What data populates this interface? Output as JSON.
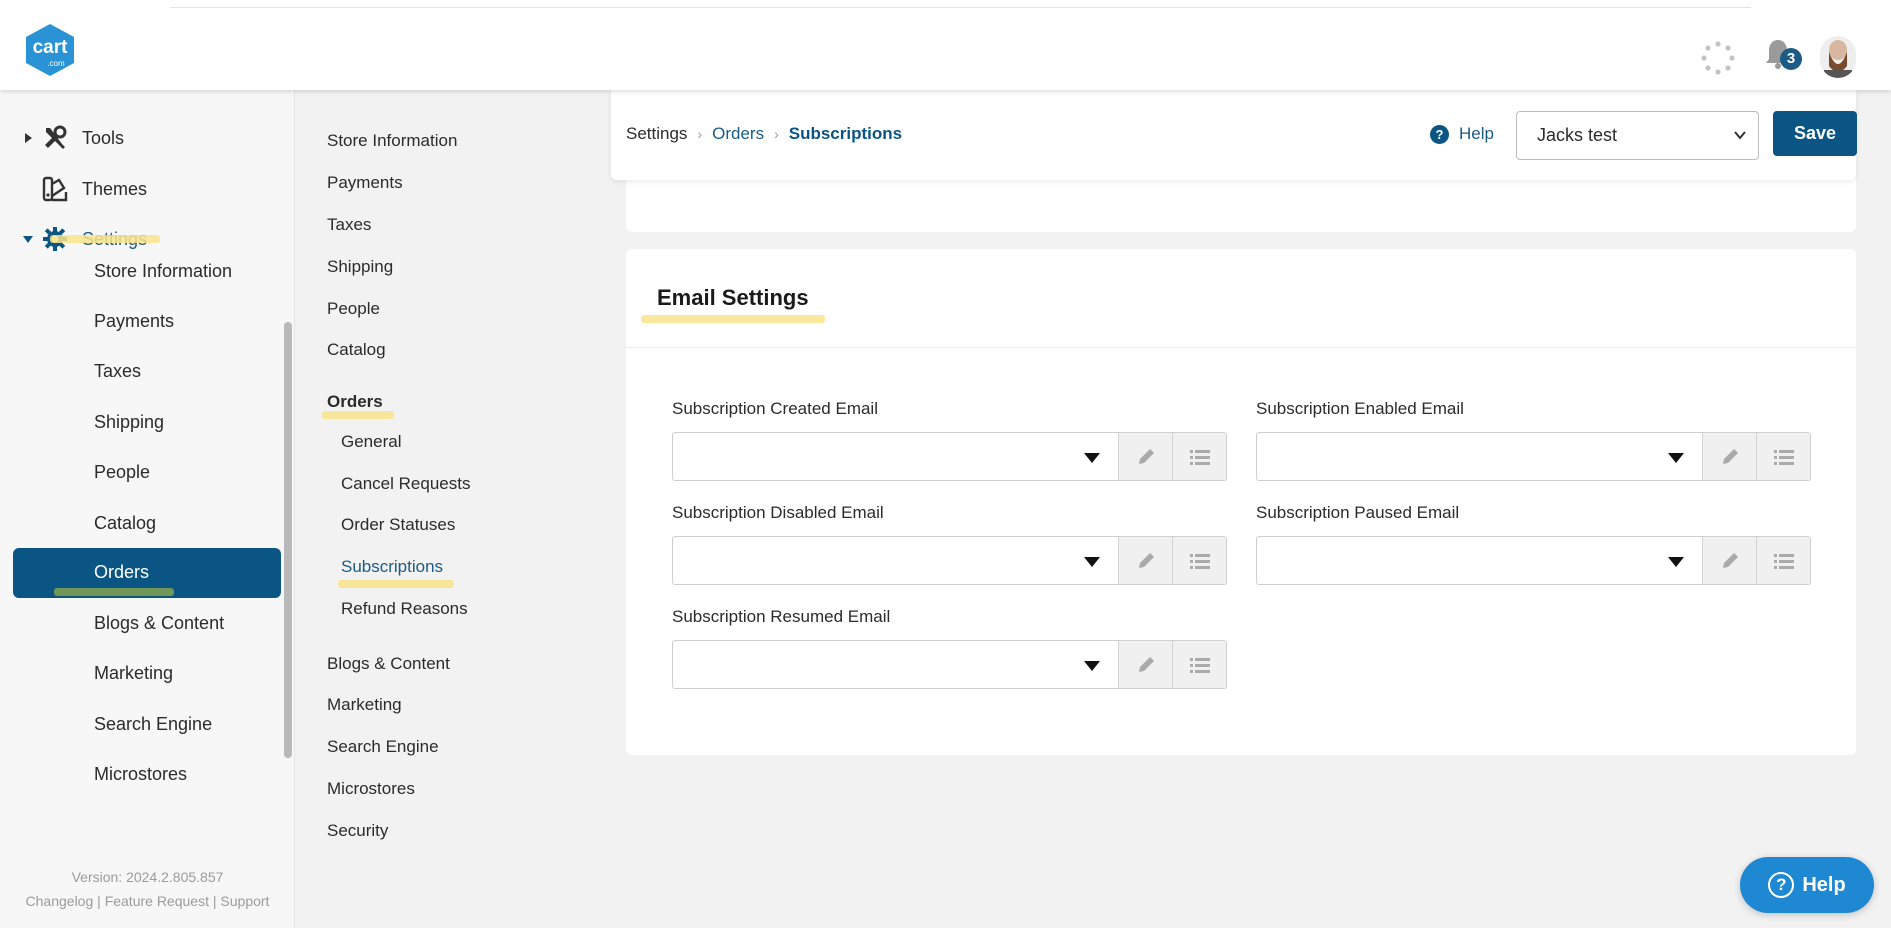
{
  "brand": {
    "logo_text": "cart",
    "logo_sub": ".com",
    "accent": "#0b5584",
    "highlight": "#f9e48b"
  },
  "topbar": {
    "notifications_count": "3"
  },
  "sidebar": {
    "sections": [
      {
        "label": "Tools",
        "icon": "tools-icon"
      },
      {
        "label": "Themes",
        "icon": "themes-icon"
      },
      {
        "label": "Settings",
        "icon": "gear-icon"
      }
    ],
    "settings_children": [
      "Store Information",
      "Payments",
      "Taxes",
      "Shipping",
      "People",
      "Catalog",
      "Orders",
      "Blogs & Content",
      "Marketing",
      "Search Engine",
      "Microstores"
    ],
    "active": "Orders",
    "version": "Version: 2024.2.805.857",
    "footer_links": [
      "Changelog",
      "Feature Request",
      "Support"
    ]
  },
  "subnav": {
    "items": [
      "Store Information",
      "Payments",
      "Taxes",
      "Shipping",
      "People",
      "Catalog"
    ],
    "orders_label": "Orders",
    "orders_children": [
      "General",
      "Cancel Requests",
      "Order Statuses",
      "Subscriptions",
      "Refund Reasons"
    ],
    "items_after": [
      "Blogs & Content",
      "Marketing",
      "Search Engine",
      "Microstores",
      "Security"
    ]
  },
  "header": {
    "breadcrumb": [
      "Settings",
      "Orders",
      "Subscriptions"
    ],
    "help_label": "Help",
    "store_selected": "Jacks test",
    "save_label": "Save"
  },
  "email_settings": {
    "title": "Email Settings",
    "fields": [
      {
        "label": "Subscription Created Email",
        "value": ""
      },
      {
        "label": "Subscription Enabled Email",
        "value": ""
      },
      {
        "label": "Subscription Disabled Email",
        "value": ""
      },
      {
        "label": "Subscription Paused Email",
        "value": ""
      },
      {
        "label": "Subscription Resumed Email",
        "value": ""
      }
    ]
  },
  "floating_help": {
    "label": "Help"
  }
}
